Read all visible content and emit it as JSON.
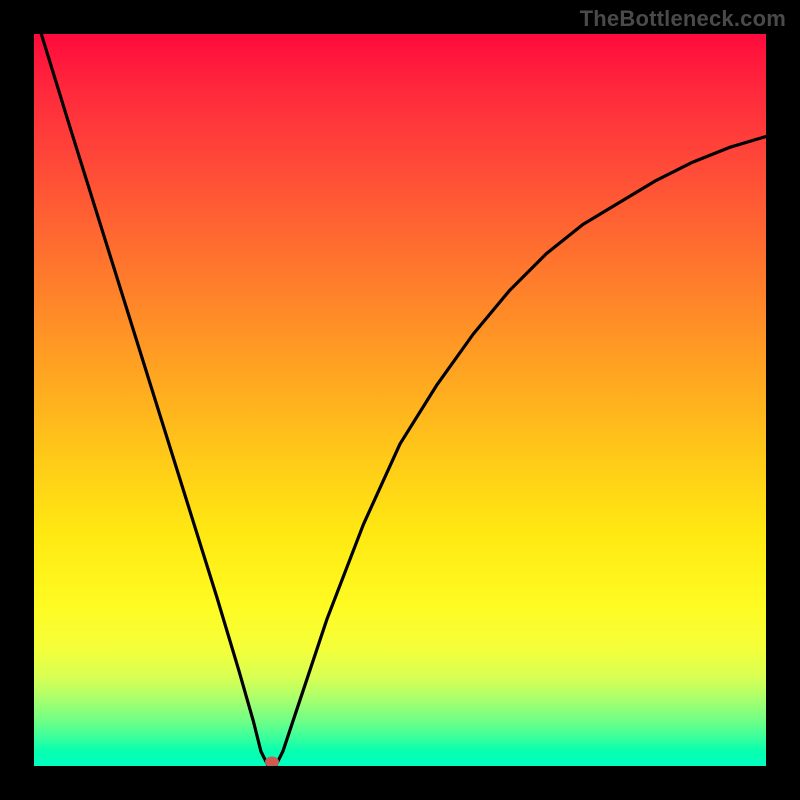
{
  "watermark": "TheBottleneck.com",
  "chart_data": {
    "type": "line",
    "title": "",
    "xlabel": "",
    "ylabel": "",
    "xlim": [
      0,
      100
    ],
    "ylim": [
      0,
      100
    ],
    "series": [
      {
        "name": "bottleneck-curve",
        "description": "V-shaped bottleneck curve: steep left descent to minimum near x≈32, then concave rise toward upper right.",
        "x": [
          1,
          5,
          10,
          15,
          20,
          25,
          28,
          30,
          31,
          32,
          33,
          34,
          36,
          40,
          45,
          50,
          55,
          60,
          65,
          70,
          75,
          80,
          85,
          90,
          95,
          100
        ],
        "y": [
          100,
          87,
          71,
          55,
          39,
          23,
          13,
          6,
          2,
          0,
          0,
          2,
          8,
          20,
          33,
          44,
          52,
          59,
          65,
          70,
          74,
          77,
          80,
          82.5,
          84.5,
          86
        ]
      }
    ],
    "marker": {
      "x": 32.5,
      "y": 0.5,
      "color": "#cc5a52"
    },
    "gradient_stops": [
      {
        "pos": 0,
        "color": "#ff0a3c"
      },
      {
        "pos": 0.5,
        "color": "#ffca18"
      },
      {
        "pos": 0.8,
        "color": "#fffb22"
      },
      {
        "pos": 1.0,
        "color": "#00ffc0"
      }
    ]
  }
}
